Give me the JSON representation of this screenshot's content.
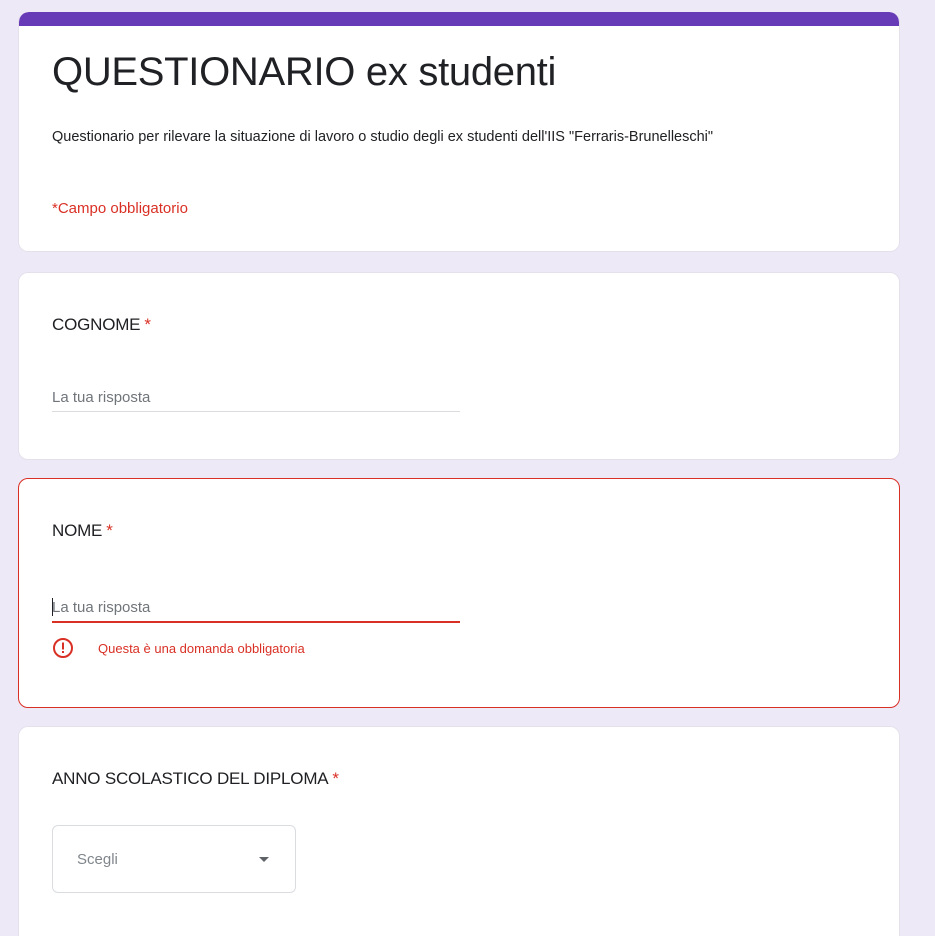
{
  "header": {
    "title": "QUESTIONARIO ex studenti",
    "description": "Questionario per rilevare la situazione di lavoro o studio degli ex studenti dell'IIS  \"Ferraris-Brunelleschi\"",
    "required_note": "*Campo obbligatorio",
    "accent_color": "#673ab7"
  },
  "questions": [
    {
      "title": "COGNOME",
      "required_mark": "*",
      "type": "short-answer",
      "placeholder": "La tua risposta",
      "value": ""
    },
    {
      "title": "NOME",
      "required_mark": "*",
      "type": "short-answer",
      "placeholder": "La tua risposta",
      "value": "",
      "state": "error",
      "error_message": "Questa è una domanda obbligatoria",
      "error_icon": "error-circle-icon"
    },
    {
      "title": "ANNO SCOLASTICO DEL DIPLOMA",
      "required_mark": "*",
      "type": "dropdown",
      "selected": "Scegli",
      "arrow_icon": "dropdown-arrow-icon"
    }
  ],
  "colors": {
    "background": "#eee9f7",
    "error": "#d93025",
    "card": "#ffffff"
  }
}
